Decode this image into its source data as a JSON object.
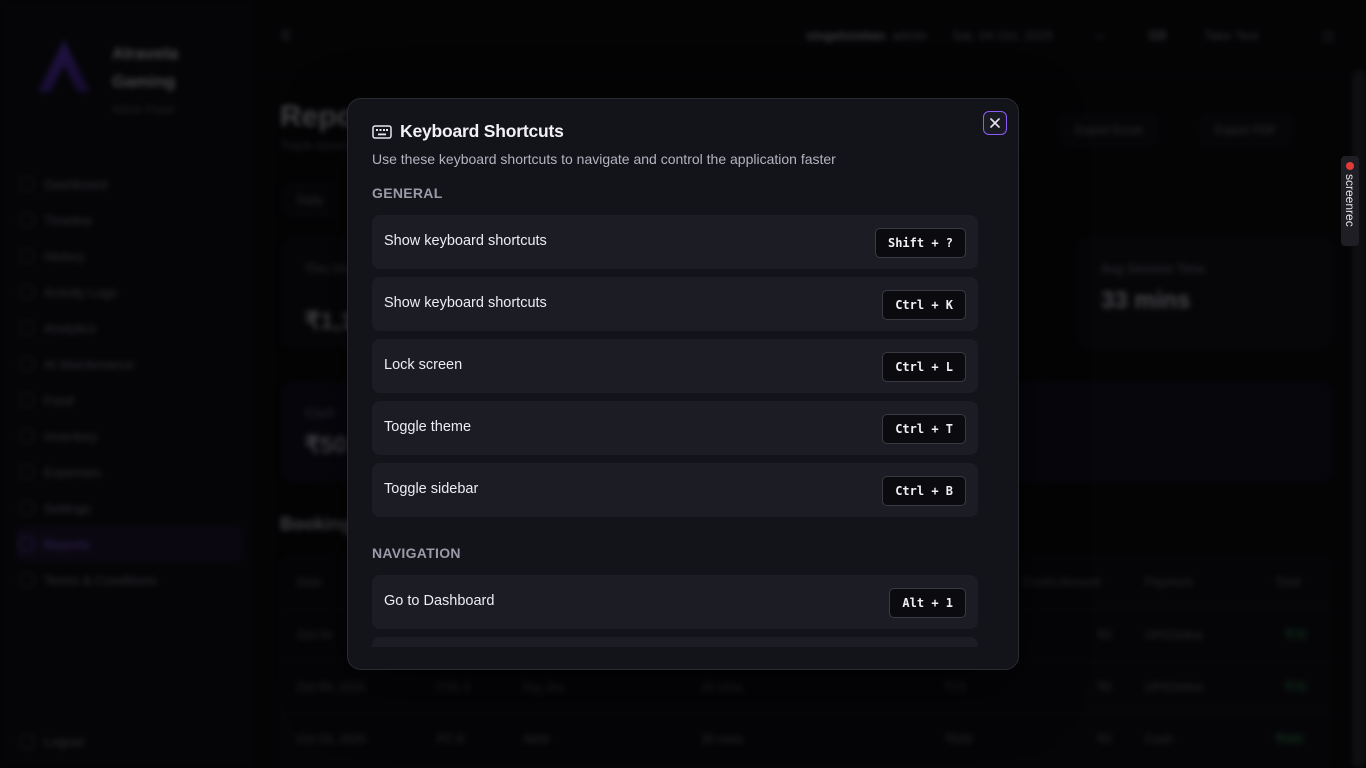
{
  "background": {
    "brand": {
      "name_line1": "Alravela",
      "name_line2": "Gaming",
      "subtitle": "Admin Panel"
    },
    "sidebar_items": [
      "Dashboard",
      "Timeline",
      "History",
      "Activity Logs",
      "Analytics",
      "AI Maintenance",
      "Food",
      "Inventory",
      "Expenses",
      "Settings",
      "Reports",
      "Terms & Conditions"
    ],
    "logout": "Logout",
    "topbar": {
      "user": "singeloistian",
      "role": "admin",
      "date": "Sat, 04 Oct, 2025",
      "take_test": "Take Test"
    },
    "page_title": "Reports",
    "page_subtitle": "Track revenue",
    "export_excel": "Export Excel",
    "export_pdf": "Export PDF",
    "filter_label": "Daily",
    "cards": [
      {
        "title": "This Month Revenue",
        "value": "₹1,1"
      },
      {
        "title": "Avg Session Time",
        "value": "33 mins"
      },
      {
        "title": "Cash",
        "value": "₹50"
      }
    ],
    "section_title": "Bookings",
    "table_headers": [
      "Date",
      "Foods Amount",
      "Payment",
      "Total"
    ],
    "rows": [
      {
        "date": "Oct 04",
        "station": "",
        "player": "",
        "duration": "",
        "amount": "",
        "foods": "₹0",
        "payment": "UPI/Online",
        "total": "₹70"
      },
      {
        "date": "Oct 04, 2025",
        "station": "PS5 3",
        "player": "Raj Jha",
        "duration": "30 mins",
        "amount": "₹70",
        "foods": "₹0",
        "payment": "UPI/Online",
        "total": "₹70"
      },
      {
        "date": "Oct 03, 2025",
        "station": "PC 8",
        "player": "Akhil",
        "duration": "30 mins",
        "amount": "₹500",
        "foods": "₹0",
        "payment": "Cash",
        "total": "₹500"
      }
    ],
    "screenrec": "screenrec"
  },
  "modal": {
    "title": "Keyboard Shortcuts",
    "description": "Use these keyboard shortcuts to navigate and control the application faster",
    "groups": [
      {
        "label": "GENERAL",
        "shortcuts": [
          {
            "label": "Show keyboard shortcuts",
            "keys": "Shift + ?"
          },
          {
            "label": "Show keyboard shortcuts",
            "keys": "Ctrl + K"
          },
          {
            "label": "Lock screen",
            "keys": "Ctrl + L"
          },
          {
            "label": "Toggle theme",
            "keys": "Ctrl + T"
          },
          {
            "label": "Toggle sidebar",
            "keys": "Ctrl + B"
          }
        ]
      },
      {
        "label": "NAVIGATION",
        "shortcuts": [
          {
            "label": "Go to Dashboard",
            "keys": "Alt + 1"
          },
          {
            "label": "",
            "keys": ""
          }
        ]
      }
    ]
  },
  "colors": {
    "accent": "#8b5cf6",
    "modal_bg": "#13131a",
    "row_bg": "#1c1c24",
    "success": "#3fbf6a"
  }
}
